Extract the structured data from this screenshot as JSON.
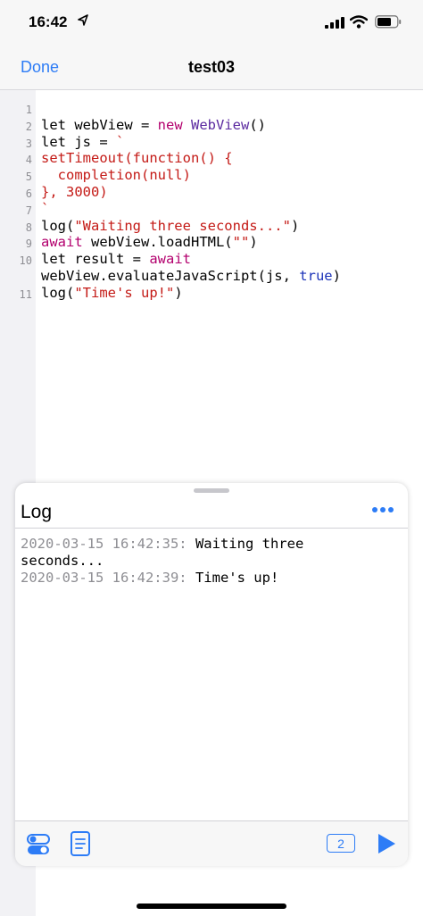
{
  "status_bar": {
    "time": "16:42"
  },
  "nav": {
    "done_label": "Done",
    "title": "test03"
  },
  "editor": {
    "line_numbers": [
      "1",
      "2",
      "3",
      "4",
      "5",
      "6",
      "7",
      "8",
      "9",
      "10",
      "11"
    ],
    "lines": [
      [],
      [
        {
          "t": "let webView = ",
          "c": "plain"
        },
        {
          "t": "new",
          "c": "kw"
        },
        {
          "t": " ",
          "c": "plain"
        },
        {
          "t": "WebView",
          "c": "ty"
        },
        {
          "t": "()",
          "c": "plain"
        }
      ],
      [
        {
          "t": "let js = ",
          "c": "plain"
        },
        {
          "t": "`",
          "c": "str"
        }
      ],
      [
        {
          "t": "setTimeout(function() {",
          "c": "str"
        }
      ],
      [
        {
          "t": "  completion(null)",
          "c": "str"
        }
      ],
      [
        {
          "t": "}, 3000)",
          "c": "str"
        }
      ],
      [
        {
          "t": "`",
          "c": "str"
        }
      ],
      [
        {
          "t": "log(",
          "c": "plain"
        },
        {
          "t": "\"Waiting three seconds...\"",
          "c": "str"
        },
        {
          "t": ")",
          "c": "plain"
        }
      ],
      [
        {
          "t": "await",
          "c": "kw"
        },
        {
          "t": " webView.loadHTML(",
          "c": "plain"
        },
        {
          "t": "\"\"",
          "c": "str"
        },
        {
          "t": ")",
          "c": "plain"
        }
      ],
      [
        {
          "t": "let result = ",
          "c": "plain"
        },
        {
          "t": "await",
          "c": "kw"
        }
      ],
      [
        {
          "t": "webView.evaluateJavaScript(js, ",
          "c": "plain"
        },
        {
          "t": "true",
          "c": "bool"
        },
        {
          "t": ")",
          "c": "plain"
        }
      ],
      [
        {
          "t": "log(",
          "c": "plain"
        },
        {
          "t": "\"Time's up!\"",
          "c": "str"
        },
        {
          "t": ")",
          "c": "plain"
        }
      ]
    ]
  },
  "log": {
    "title": "Log",
    "entries": [
      {
        "timestamp": "2020-03-15 16:42:35:",
        "message": " Waiting three"
      },
      {
        "timestamp": "",
        "message": "seconds..."
      },
      {
        "timestamp": "2020-03-15 16:42:39:",
        "message": " Time's up!"
      }
    ],
    "badge_count": "2"
  },
  "colors": {
    "accent": "#2d7cf6",
    "keyword": "#b3006e",
    "string": "#c41a16",
    "type": "#5b2aa0",
    "bool": "#1c33b8"
  }
}
